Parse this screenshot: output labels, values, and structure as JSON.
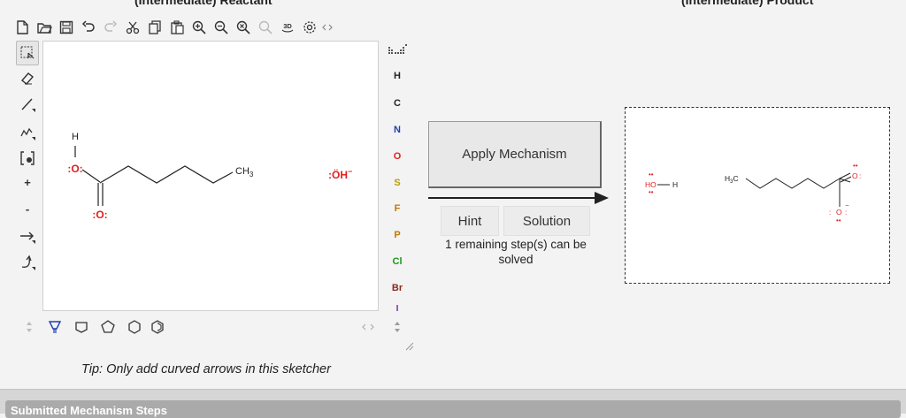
{
  "headers": {
    "reactant": "(Intermediate) Reactant",
    "product": "(Intermediate) Product"
  },
  "toolbar": {
    "icons": [
      "new-document-icon",
      "open-icon",
      "save-icon",
      "undo-icon",
      "redo-icon",
      "cut-icon",
      "copy-icon",
      "paste-icon",
      "zoom-in-icon",
      "zoom-out-icon",
      "zoom-reset-icon",
      "zoom-fit-icon",
      "3d-view-icon",
      "settings-icon",
      "expand-icon"
    ],
    "view3d_label": "3D"
  },
  "left_tools": {
    "plus_label": "+",
    "minus_label": "-"
  },
  "elements": [
    "H",
    "C",
    "N",
    "O",
    "S",
    "F",
    "P",
    "Cl",
    "Br",
    "I"
  ],
  "element_colors": {
    "H": "#222222",
    "C": "#222222",
    "N": "#1f3fb0",
    "O": "#e02020",
    "S": "#b8a000",
    "F": "#c07800",
    "P": "#c07800",
    "Cl": "#1a9a1a",
    "Br": "#8a2b1a",
    "I": "#7a2aa0"
  },
  "reactant": {
    "h_label": "H",
    "o_top_label": ":O:",
    "o_bottom_label": ":O:",
    "ch3_label": "CH",
    "ch3_sub": "3",
    "hydroxide_label": ":ÖH",
    "hydroxide_charge": "−"
  },
  "mechanism": {
    "apply_label": "Apply Mechanism",
    "hint_label": "Hint",
    "solution_label": "Solution",
    "remaining_text": "1 remaining step(s) can be solved"
  },
  "product": {
    "water_o": "HO",
    "water_h": "H",
    "h3c_label": "H",
    "h3c_sub": "3",
    "h3c_c": "C",
    "o_right": "O",
    "o_bottom": "O",
    "o_bottom_charge": "−"
  },
  "tip": "Tip: Only add curved arrows in this sketcher",
  "footer_title": "Submitted Mechanism Steps",
  "colors": {
    "oxygen": "#e02020",
    "bond": "#222222",
    "accent": "#333333"
  }
}
